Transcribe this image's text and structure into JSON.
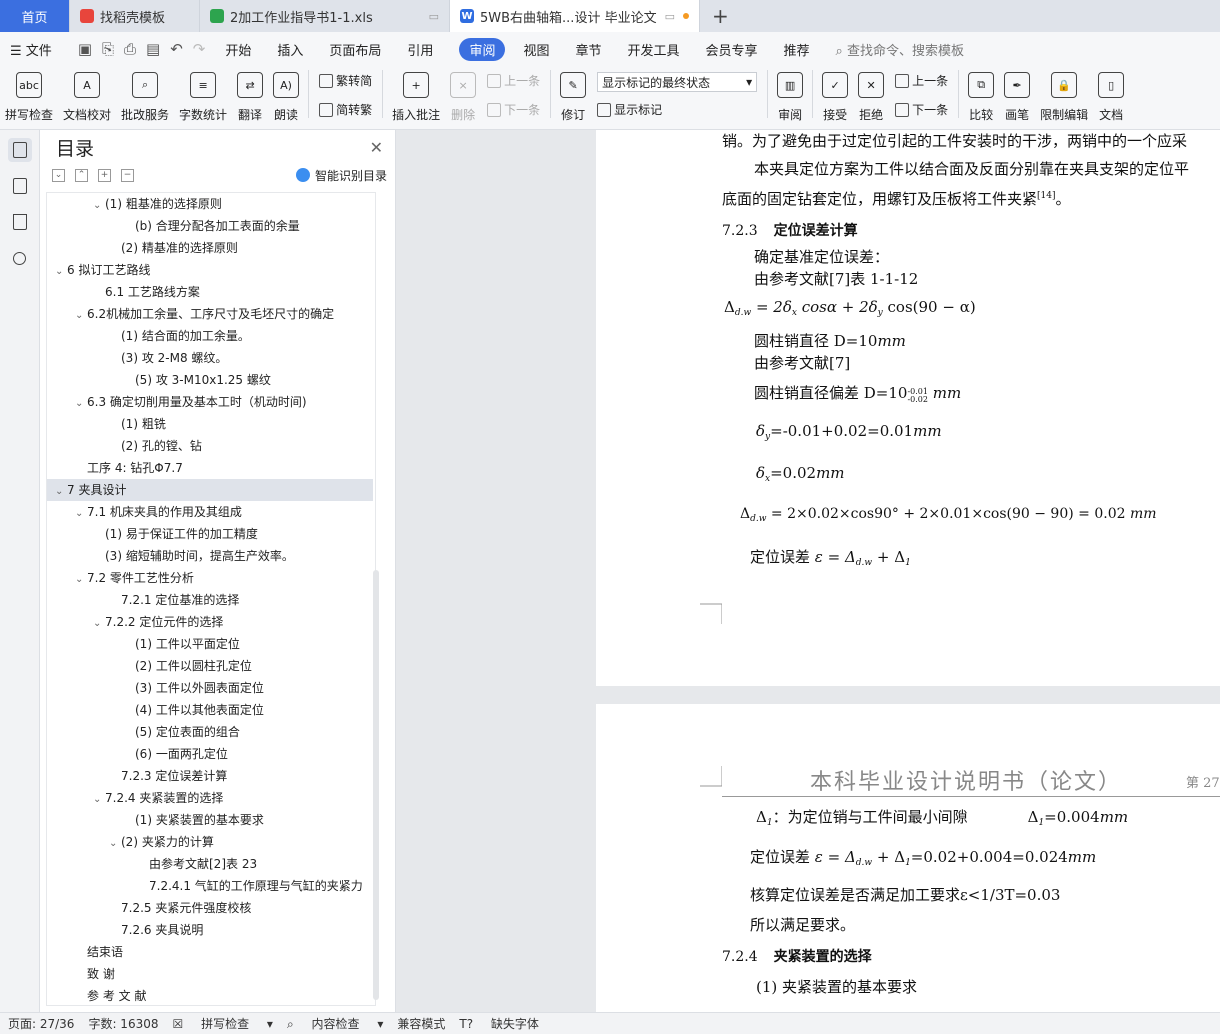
{
  "tabs": {
    "home": "首页",
    "t1": "找稻壳模板",
    "t2": "2加工作业指导书1-1.xls",
    "t3": "5WB右曲轴箱...设计 毕业论文"
  },
  "menu": {
    "file": "文件",
    "items": [
      "开始",
      "插入",
      "页面布局",
      "引用",
      "审阅",
      "视图",
      "章节",
      "开发工具",
      "会员专享",
      "推荐"
    ],
    "search": "查找命令、搜索模板"
  },
  "ribbon": {
    "spell": "拼写检查",
    "proof": "文档校对",
    "batch": "批改服务",
    "wordcount": "字数统计",
    "translate": "翻译",
    "read": "朗读",
    "to_trad": "繁转简",
    "to_simp": "简转繁",
    "insert_comment": "插入批注",
    "delete": "删除",
    "prev": "上一条",
    "next": "下一条",
    "revise": "修订",
    "markup_select": "显示标记的最终状态",
    "show_markup": "显示标记",
    "review": "审阅",
    "accept": "接受",
    "reject": "拒绝",
    "prev2": "上一条",
    "next2": "下一条",
    "compare": "比较",
    "ink": "画笔",
    "restrict": "限制编辑",
    "doc_more": "文档"
  },
  "toc": {
    "title": "目录",
    "smart": "智能识别目录",
    "items": [
      {
        "t": "(1) 粗基准的选择原则",
        "i": 2,
        "a": "v"
      },
      {
        "t": "(b) 合理分配各加工表面的余量",
        "i": 4,
        "a": ""
      },
      {
        "t": "(2) 精基准的选择原则",
        "i": 3,
        "a": ""
      },
      {
        "t": "6 拟订工艺路线",
        "i": 0,
        "a": "v"
      },
      {
        "t": "6.1 工艺路线方案",
        "i": 2,
        "a": ""
      },
      {
        "t": "6.2机械加工余量、工序尺寸及毛坯尺寸的确定",
        "i": 1,
        "a": "v"
      },
      {
        "t": "(1) 结合面的加工余量。",
        "i": 3,
        "a": ""
      },
      {
        "t": "(3) 攻 2-M8 螺纹。",
        "i": 3,
        "a": ""
      },
      {
        "t": "(5) 攻 3-M10x1.25 螺纹",
        "i": 4,
        "a": ""
      },
      {
        "t": "6.3 确定切削用量及基本工时（机动时间)",
        "i": 1,
        "a": "v"
      },
      {
        "t": "(1) 粗铣",
        "i": 3,
        "a": ""
      },
      {
        "t": "(2) 孔的镗、钻",
        "i": 3,
        "a": ""
      },
      {
        "t": "工序 4: 钻孔Φ7.7",
        "i": 1,
        "a": ""
      },
      {
        "t": "7 夹具设计",
        "i": 0,
        "a": "v",
        "sel": true
      },
      {
        "t": "7.1 机床夹具的作用及其组成",
        "i": 1,
        "a": "v"
      },
      {
        "t": "(1) 易于保证工件的加工精度",
        "i": 2,
        "a": ""
      },
      {
        "t": "(3) 缩短辅助时间，提高生产效率。",
        "i": 2,
        "a": ""
      },
      {
        "t": "7.2 零件工艺性分析",
        "i": 1,
        "a": "v"
      },
      {
        "t": "7.2.1 定位基准的选择",
        "i": 3,
        "a": ""
      },
      {
        "t": "7.2.2 定位元件的选择",
        "i": 2,
        "a": "v"
      },
      {
        "t": "(1) 工件以平面定位",
        "i": 4,
        "a": ""
      },
      {
        "t": "(2) 工件以圆柱孔定位",
        "i": 4,
        "a": ""
      },
      {
        "t": "(3) 工件以外圆表面定位",
        "i": 4,
        "a": ""
      },
      {
        "t": "(4) 工件以其他表面定位",
        "i": 4,
        "a": ""
      },
      {
        "t": "(5) 定位表面的组合",
        "i": 4,
        "a": ""
      },
      {
        "t": "(6) 一面两孔定位",
        "i": 4,
        "a": ""
      },
      {
        "t": "7.2.3 定位误差计算",
        "i": 3,
        "a": ""
      },
      {
        "t": "7.2.4 夹紧装置的选择",
        "i": 2,
        "a": "v"
      },
      {
        "t": "(1) 夹紧装置的基本要求",
        "i": 4,
        "a": ""
      },
      {
        "t": "(2) 夹紧力的计算",
        "i": 3,
        "a": "v"
      },
      {
        "t": "由参考文献[2]表 23",
        "i": 5,
        "a": ""
      },
      {
        "t": "7.2.4.1 气缸的工作原理与气缸的夹紧力",
        "i": 5,
        "a": ""
      },
      {
        "t": "7.2.5 夹紧元件强度校核",
        "i": 3,
        "a": ""
      },
      {
        "t": "7.2.6 夹具说明",
        "i": 3,
        "a": ""
      },
      {
        "t": "结束语",
        "i": 1,
        "a": ""
      },
      {
        "t": "致 谢",
        "i": 1,
        "a": ""
      },
      {
        "t": "参 考 文 献",
        "i": 1,
        "a": ""
      }
    ]
  },
  "doc": {
    "p1_line0": "销。为了避免由于过定位引起的工件安装时的干涉，两销中的一个应采",
    "p1_line1": "本夹具定位方案为工件以结合面及反面分别靠在夹具支架的定位平",
    "p1_line2": "底面的固定钻套定位，用螺钉及压板将工件夹紧",
    "p1_line2_ref": "[14]",
    "p1_line2_end": "。",
    "sec_723_num": "7.2.3",
    "sec_723_title": "定位误差计算",
    "l_basic": "确定基准定位误差：",
    "l_ref1": "由参考文献[7]表 1-1-12",
    "f1": "= 2δ",
    "f1b": " cosα + 2δ",
    "f1c": " cos(90 − α)",
    "l_d": "圆柱销直径 D=10",
    "l_ref7": "由参考文献[7]",
    "l_dev": "圆柱销直径偏差 D=10",
    "l_dev_sup": "-0.01",
    "l_dev_sub": "-0.02",
    "l_dy": "=-0.01+0.02=0.01",
    "l_dx": "=0.02",
    "f2": "= 2×0.02×cos90° + 2×0.01×cos(90 − 90) = 0.02",
    "l_eps": "定位误差",
    "l_eps_f": "ε = Δ",
    "l_eps_f2": " + Δ",
    "mm": "mm",
    "dw": "d.w",
    "sx": "x",
    "sy": "y",
    "s1": "1",
    "header": "本科毕业设计说明书（论文）",
    "header_pg": "第 27",
    "p2_l1": "：为定位销与工件间最小间隙",
    "p2_l1b": "=0.004",
    "p2_eps": "定位误差",
    "p2_eps_f": "ε = Δ",
    "p2_eps_f2": " + Δ",
    "p2_eps_f3": "=0.02+0.004=0.024",
    "p2_check": "核算定位误差是否满足加工要求ε<1/3T=0.03",
    "p2_ok": "所以满足要求。",
    "sec_724_num": "7.2.4",
    "sec_724_title": "夹紧装置的选择",
    "p2_sub1": "(1) 夹紧装置的基本要求"
  },
  "status": {
    "page": "页面: 27/36",
    "words": "字数: 16308",
    "spell": "拼写检查",
    "content": "内容检查",
    "compat": "兼容模式",
    "font": "缺失字体"
  }
}
